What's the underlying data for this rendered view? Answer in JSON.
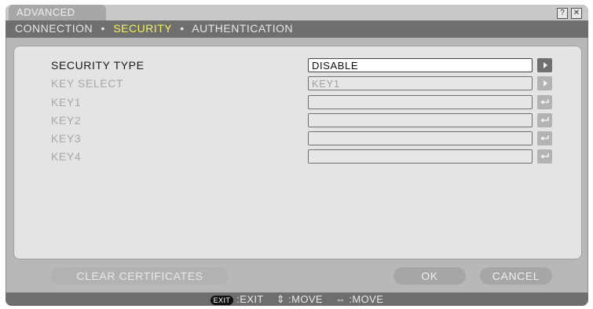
{
  "window": {
    "tab_title": "ADVANCED",
    "breadcrumb": {
      "items": [
        "CONNECTION",
        "SECURITY",
        "AUTHENTICATION"
      ],
      "active": "SECURITY"
    },
    "top_icons": [
      "help-icon",
      "close-icon"
    ]
  },
  "settings": {
    "rows": [
      {
        "label": "SECURITY TYPE",
        "value": "DISABLE",
        "enabled": true,
        "control": "arrow-right"
      },
      {
        "label": "KEY SELECT",
        "value": "KEY1",
        "enabled": false,
        "control": "arrow-right"
      },
      {
        "label": "KEY1",
        "value": "",
        "enabled": false,
        "control": "enter"
      },
      {
        "label": "KEY2",
        "value": "",
        "enabled": false,
        "control": "enter"
      },
      {
        "label": "KEY3",
        "value": "",
        "enabled": false,
        "control": "enter"
      },
      {
        "label": "KEY4",
        "value": "",
        "enabled": false,
        "control": "enter"
      }
    ]
  },
  "buttons": {
    "clear_certificates": "CLEAR CERTIFICATES",
    "ok": "OK",
    "cancel": "CANCEL"
  },
  "statusbar": {
    "exit_key": "EXIT",
    "exit_label": ":EXIT",
    "move_vertical_label": ":MOVE",
    "move_horizontal_label": ":MOVE",
    "icons": [
      "exit-key-icon",
      "up-down-arrow-icon",
      "left-right-arrow-icon"
    ]
  },
  "colors": {
    "accent_active": "#f6ef5a",
    "header_bar": "#6f6f6f"
  }
}
